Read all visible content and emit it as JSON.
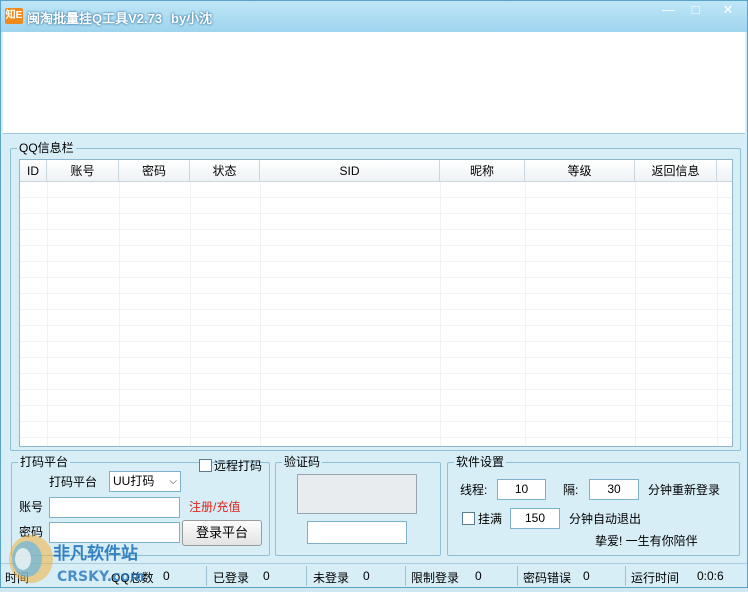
{
  "window": {
    "title": "闽淘批量挂Q工具V2.73",
    "author": "by小沈",
    "icon_text": "知E",
    "controls": {
      "minimize": "—",
      "maximize": "□",
      "close": "✕"
    }
  },
  "qq_info": {
    "group_title": "QQ信息栏",
    "columns": [
      "ID",
      "账号",
      "密码",
      "状态",
      "SID",
      "昵称",
      "等级",
      "返回信息"
    ],
    "rows": []
  },
  "captcha_platform": {
    "group_title": "打码平台",
    "remote_label": "远程打码",
    "platform_label": "打码平台",
    "platform_value": "UU打码",
    "account_label": "账号",
    "account_value": "",
    "register_link": "注册/充值",
    "password_label": "密码",
    "password_value": "",
    "login_button": "登录平台"
  },
  "captcha": {
    "group_title": "验证码",
    "input_value": ""
  },
  "settings": {
    "group_title": "软件设置",
    "threads_label": "线程:",
    "threads_value": "10",
    "interval_label": "隔:",
    "interval_value": "30",
    "relogin_label": "分钟重新登录",
    "full_label": "挂满",
    "full_value": "150",
    "auto_exit_label": "分钟自动退出",
    "slogan": "挚爱! 一生有你陪伴"
  },
  "statusbar": {
    "items": [
      {
        "label": "时间",
        "value": ""
      },
      {
        "label": "QQ总数",
        "value": "0"
      },
      {
        "label": "已登录",
        "value": "0"
      },
      {
        "label": "未登录",
        "value": "0"
      },
      {
        "label": "限制登录",
        "value": "0"
      },
      {
        "label": "密码错误",
        "value": "0"
      },
      {
        "label": "运行时间",
        "value": "0:0:6"
      }
    ]
  },
  "watermark": {
    "line1": "非凡软件站",
    "line2": "CRSKY.com"
  },
  "colors": {
    "link_red": "#e0231a",
    "titlebar": "#9fd4ee",
    "window_bg": "#d7eef7"
  }
}
